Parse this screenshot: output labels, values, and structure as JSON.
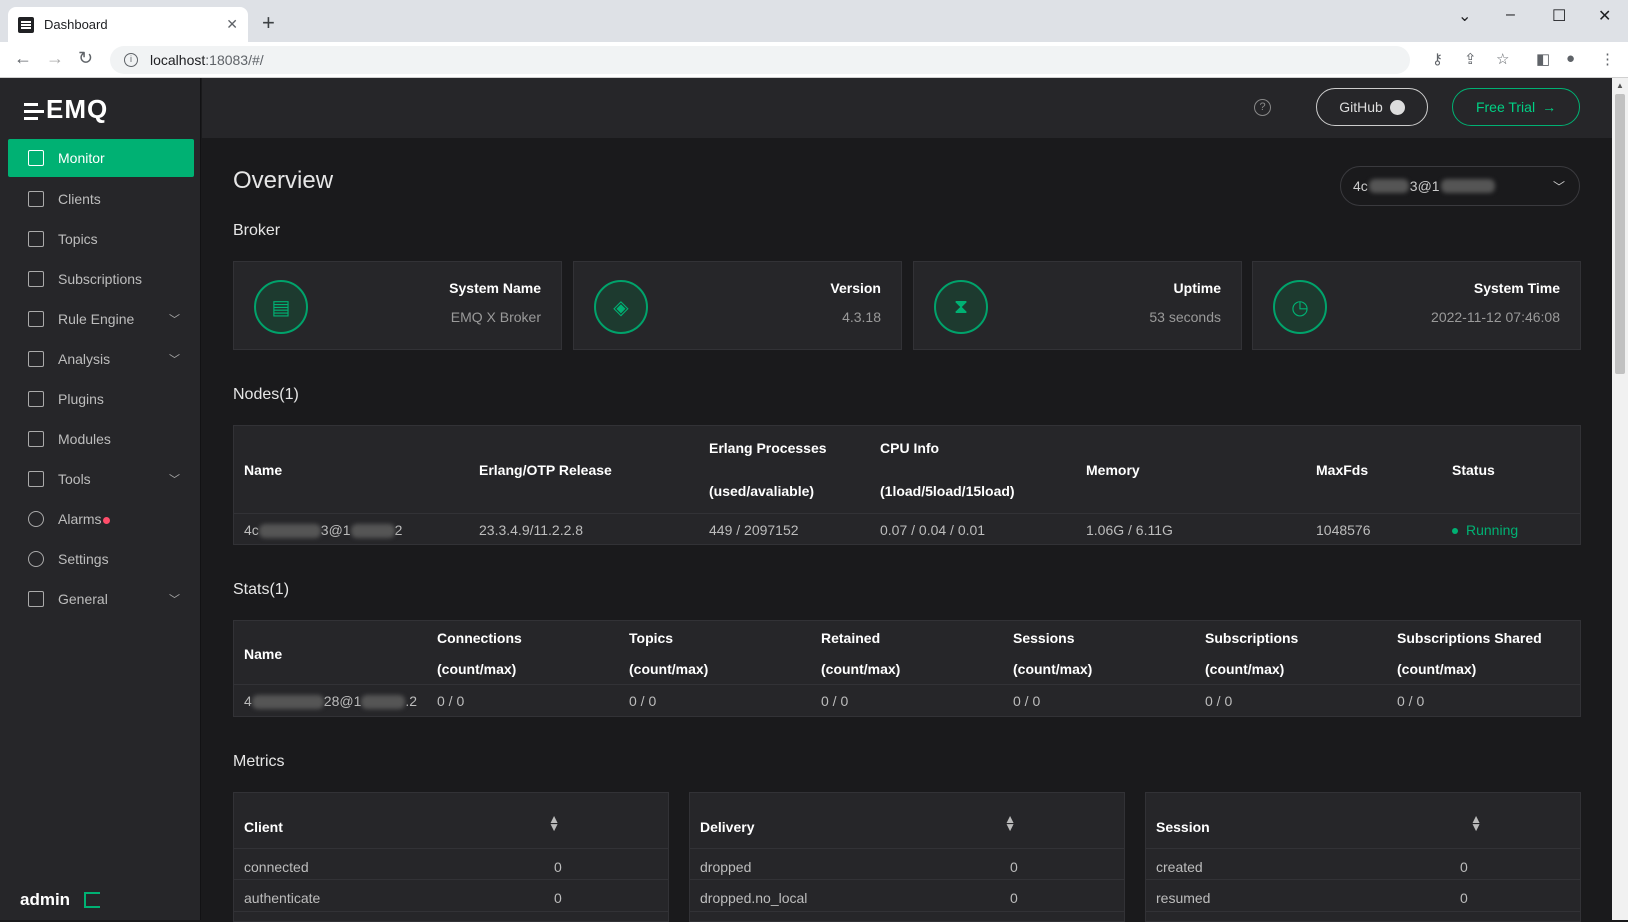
{
  "browser": {
    "tab_title": "Dashboard",
    "url_host": "localhost",
    "url_path": ":18083/#/"
  },
  "sidebar": {
    "logo": "EMQ",
    "items": [
      {
        "label": "Monitor",
        "icon": "monitor-icon",
        "active": true
      },
      {
        "label": "Clients",
        "icon": "clients-icon"
      },
      {
        "label": "Topics",
        "icon": "topics-icon"
      },
      {
        "label": "Subscriptions",
        "icon": "subscriptions-icon"
      },
      {
        "label": "Rule Engine",
        "icon": "rule-engine-icon",
        "expandable": true
      },
      {
        "label": "Analysis",
        "icon": "analysis-icon",
        "expandable": true
      },
      {
        "label": "Plugins",
        "icon": "plugins-icon"
      },
      {
        "label": "Modules",
        "icon": "modules-icon"
      },
      {
        "label": "Tools",
        "icon": "tools-icon",
        "expandable": true
      },
      {
        "label": "Alarms",
        "icon": "alarms-icon",
        "badge": true
      },
      {
        "label": "Settings",
        "icon": "settings-icon"
      },
      {
        "label": "General",
        "icon": "general-icon",
        "expandable": true
      }
    ],
    "user": "admin"
  },
  "header": {
    "github_label": "GitHub",
    "free_trial_label": "Free Trial"
  },
  "overview": {
    "title": "Overview",
    "node_select_prefix": "4c",
    "node_select_mid": "3@1"
  },
  "broker": {
    "section_title": "Broker",
    "cards": [
      {
        "label": "System Name",
        "value": "EMQ X Broker",
        "icon": "document-icon"
      },
      {
        "label": "Version",
        "value": "4.3.18",
        "icon": "layers-icon"
      },
      {
        "label": "Uptime",
        "value": "53 seconds",
        "icon": "hourglass-icon"
      },
      {
        "label": "System Time",
        "value": "2022-11-12 07:46:08",
        "icon": "clock-icon"
      }
    ]
  },
  "nodes": {
    "section_title": "Nodes(1)",
    "headers": {
      "name": "Name",
      "otp": "Erlang/OTP Release",
      "proc1": "Erlang Processes",
      "proc2": "(used/avaliable)",
      "cpu1": "CPU Info",
      "cpu2": "(1load/5load/15load)",
      "memory": "Memory",
      "maxfds": "MaxFds",
      "status": "Status"
    },
    "row": {
      "name_a": "4c",
      "name_b": "3@1",
      "name_c": "2",
      "otp": "23.3.4.9/11.2.2.8",
      "proc": "449 / 2097152",
      "cpu": "0.07 / 0.04 / 0.01",
      "memory": "1.06G / 6.11G",
      "maxfds": "1048576",
      "status": "Running"
    }
  },
  "stats": {
    "section_title": "Stats(1)",
    "headers": {
      "name": "Name",
      "connections": "Connections",
      "topics": "Topics",
      "retained": "Retained",
      "sessions": "Sessions",
      "subscriptions": "Subscriptions",
      "subs_shared": "Subscriptions Shared",
      "unit": "(count/max)"
    },
    "row": {
      "name_a": "4",
      "name_b": "28@1",
      "name_c": ".2",
      "connections": "0 / 0",
      "topics": "0 / 0",
      "retained": "0 / 0",
      "sessions": "0 / 0",
      "subscriptions": "0 / 0",
      "subs_shared": "0 / 0"
    }
  },
  "metrics": {
    "section_title": "Metrics",
    "cards": [
      {
        "title": "Client",
        "rows": [
          {
            "k": "connected",
            "v": "0"
          },
          {
            "k": "authenticate",
            "v": "0"
          }
        ]
      },
      {
        "title": "Delivery",
        "rows": [
          {
            "k": "dropped",
            "v": "0"
          },
          {
            "k": "dropped.no_local",
            "v": "0"
          }
        ]
      },
      {
        "title": "Session",
        "rows": [
          {
            "k": "created",
            "v": "0"
          },
          {
            "k": "resumed",
            "v": "0"
          }
        ]
      }
    ]
  }
}
